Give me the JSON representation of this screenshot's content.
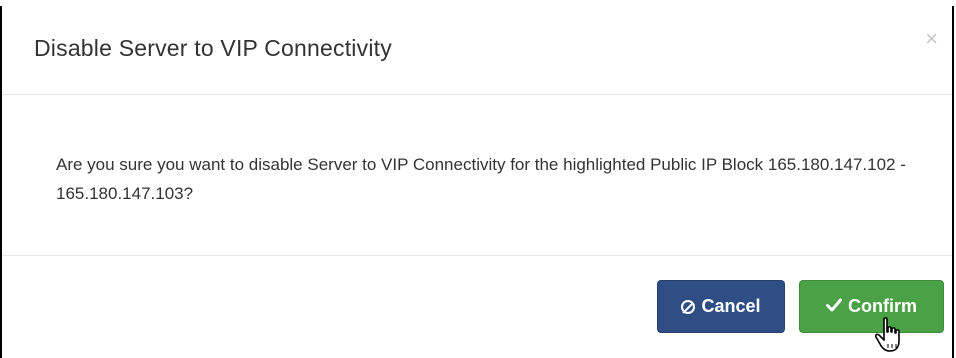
{
  "modal": {
    "title": "Disable Server to VIP Connectivity",
    "close_label": "×",
    "message": "Are you sure you want to disable Server to VIP Connectivity for the highlighted Public IP Block 165.180.147.102 - 165.180.147.103?",
    "cancel_label": "Cancel",
    "confirm_label": "Confirm"
  },
  "icons": {
    "close": "close-icon",
    "cancel": "ban-icon",
    "confirm": "check-icon",
    "cursor": "hand-pointer-icon"
  },
  "colors": {
    "cancel_button": "#2f4f84",
    "confirm_button": "#4aa146",
    "title_text": "#333333",
    "close_icon": "#c7c7c7"
  }
}
